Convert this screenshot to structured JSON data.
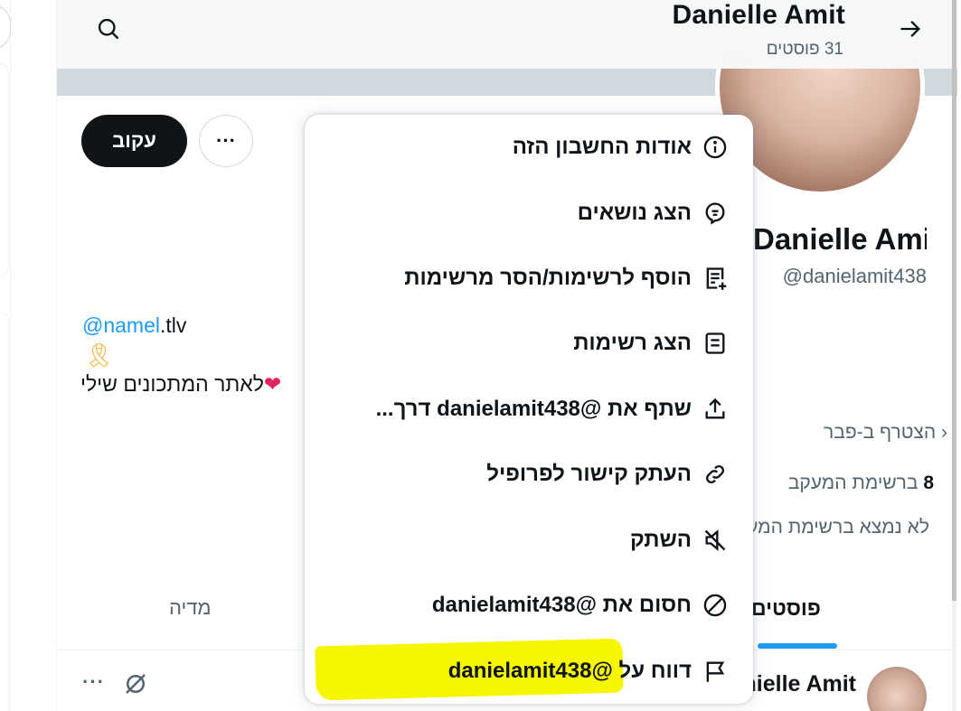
{
  "header": {
    "title": "Danielle Amit",
    "subtitle": "31 פוסטים",
    "back_icon": "arrow-right-icon",
    "search_icon": "search-icon"
  },
  "profile": {
    "name": "Danielle Amit",
    "handle": "@danielamit438",
    "follow_label": "עקוב",
    "more_label": "···",
    "bio_mention": "@namel",
    "bio_link_rest": ".tlv",
    "bio_ribbon": "🎗",
    "bio_line": "לאתר המתכונים שילי",
    "joined": "הצטרף ב-פבר",
    "following_count": "8",
    "following_text": "ברשימת המעקב",
    "not_followed": "לא נמצא ברשימת המעקב"
  },
  "tabs": {
    "posts": "פוסטים",
    "media": "מדיה"
  },
  "tweet": {
    "author": "Danielle Amit",
    "dots": "···"
  },
  "menu": {
    "items": [
      {
        "label": "אודות החשבון הזה",
        "icon": "info-icon"
      },
      {
        "label": "הצג נושאים",
        "icon": "topics-icon"
      },
      {
        "label": "הוסף לרשימות/הסר מרשימות",
        "icon": "list-add-icon"
      },
      {
        "label": "הצג רשימות",
        "icon": "list-icon"
      },
      {
        "label": "שתף את @danielamit438 דרך...",
        "icon": "share-icon"
      },
      {
        "label": "העתק קישור לפרופיל",
        "icon": "link-icon"
      },
      {
        "label": "השתק",
        "icon": "mute-icon"
      },
      {
        "label": "חסום את @danielamit438",
        "icon": "block-icon"
      },
      {
        "label": "דווח על @danielamit438",
        "icon": "flag-icon"
      }
    ]
  },
  "colors": {
    "accent": "#1d9bf0",
    "text": "#0f1419",
    "secondary": "#536471",
    "highlight": "#f6f600"
  }
}
